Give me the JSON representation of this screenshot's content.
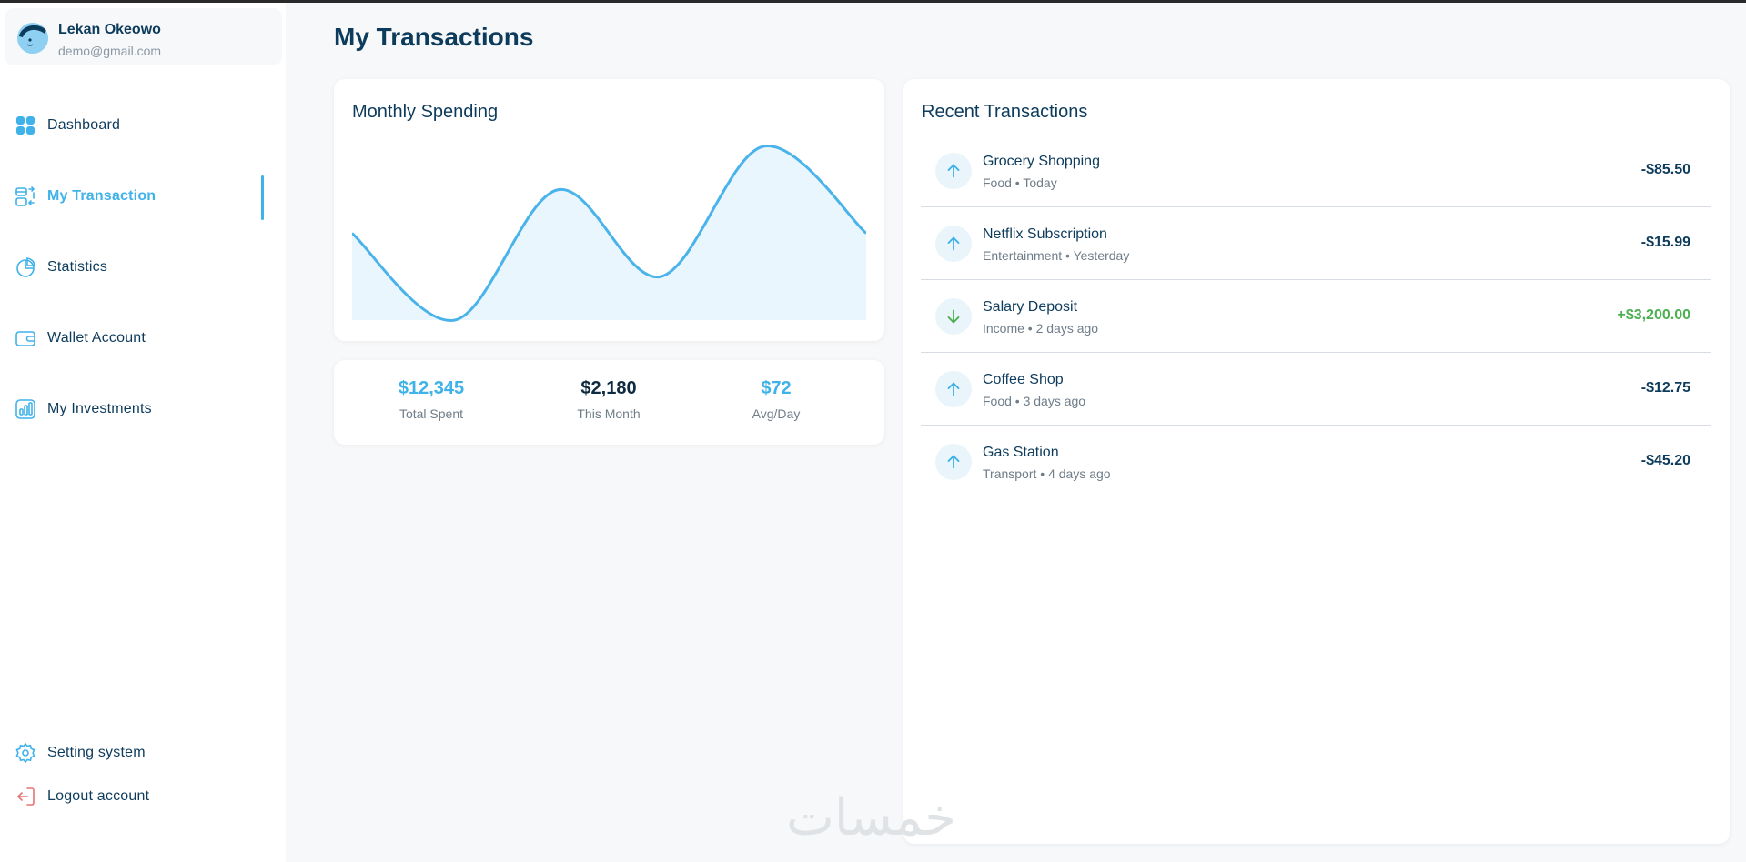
{
  "profile": {
    "name": "Lekan Okeowo",
    "email": "demo@gmail.com"
  },
  "nav": {
    "items": [
      {
        "label": "Dashboard",
        "icon": "dashboard-grid-icon"
      },
      {
        "label": "My Transaction",
        "icon": "transaction-icon",
        "active": true
      },
      {
        "label": "Statistics",
        "icon": "pie-chart-icon"
      },
      {
        "label": "Wallet Account",
        "icon": "wallet-icon"
      },
      {
        "label": "My Investments",
        "icon": "bar-chart-icon"
      }
    ],
    "bottom": [
      {
        "label": "Setting system",
        "icon": "gear-icon"
      },
      {
        "label": "Logout account",
        "icon": "logout-icon"
      }
    ]
  },
  "page": {
    "title": "My Transactions"
  },
  "spending": {
    "title": "Monthly Spending",
    "chart_data": {
      "type": "area",
      "x": [
        0,
        1,
        2,
        3,
        4,
        5
      ],
      "values": [
        50,
        0,
        75,
        25,
        100,
        50
      ],
      "title": "Monthly Spending",
      "xlabel": "",
      "ylabel": "",
      "grid": false,
      "line_color": "#4ab3ea",
      "fill_color": "#eaf6fd"
    }
  },
  "stats": [
    {
      "value": "$12,345",
      "label": "Total Spent",
      "color": "#3fb2ea"
    },
    {
      "value": "$2,180",
      "label": "This Month",
      "color": "#0d2a40"
    },
    {
      "value": "$72",
      "label": "Avg/Day",
      "color": "#3fb2ea"
    }
  ],
  "recent": {
    "title": "Recent Transactions",
    "transactions": [
      {
        "name": "Grocery Shopping",
        "meta": "Food • Today",
        "amount": "-$85.50",
        "direction": "up"
      },
      {
        "name": "Netflix Subscription",
        "meta": "Entertainment • Yesterday",
        "amount": "-$15.99",
        "direction": "up"
      },
      {
        "name": "Salary Deposit",
        "meta": "Income • 2 days ago",
        "amount": "+$3,200.00",
        "direction": "down"
      },
      {
        "name": "Coffee Shop",
        "meta": "Food • 3 days ago",
        "amount": "-$12.75",
        "direction": "up"
      },
      {
        "name": "Gas Station",
        "meta": "Transport • 4 days ago",
        "amount": "-$45.20",
        "direction": "up"
      }
    ]
  },
  "watermark": "خمسات"
}
